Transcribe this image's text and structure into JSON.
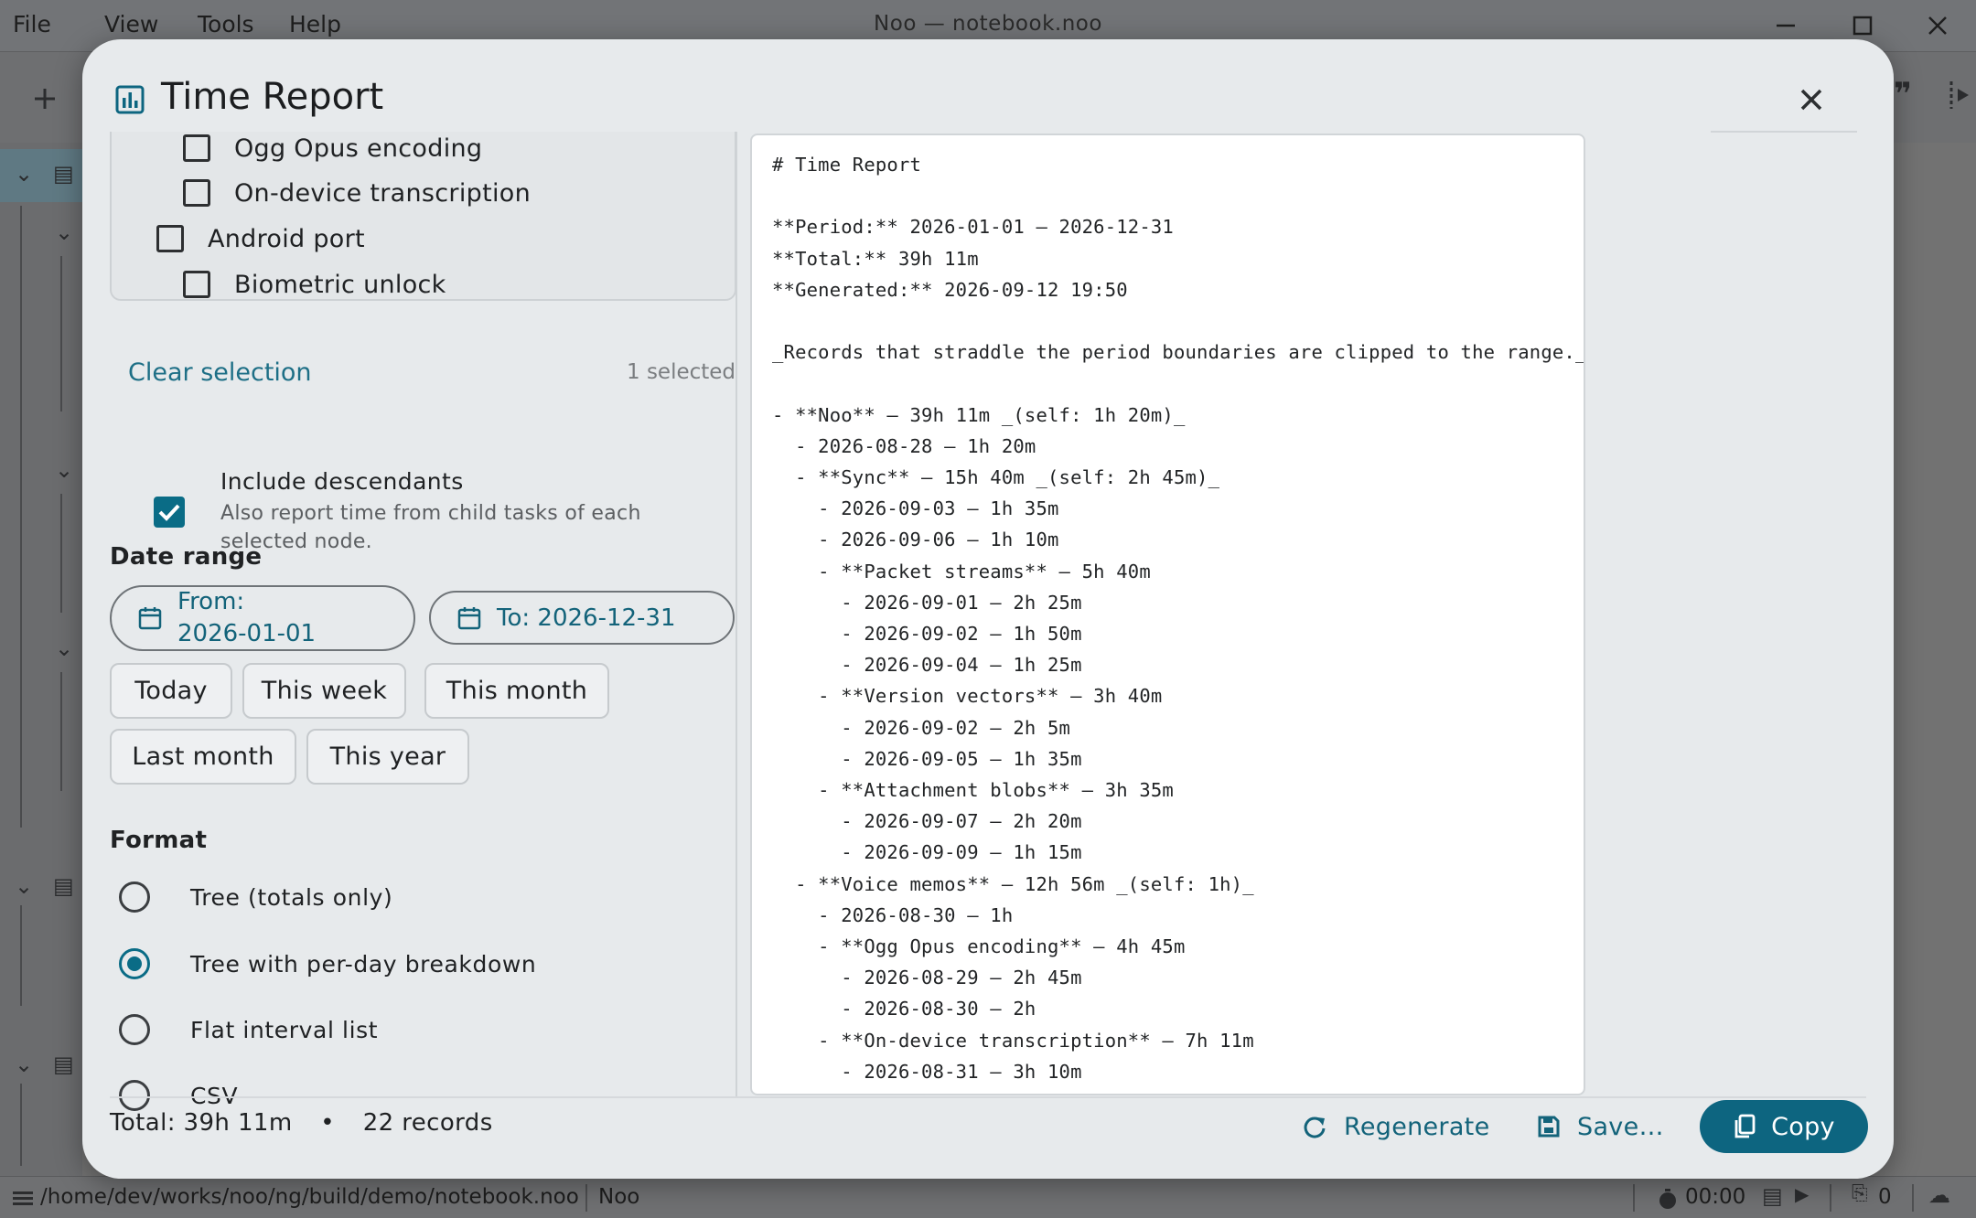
{
  "app": {
    "menu": [
      "File",
      "View",
      "Tools",
      "Help"
    ],
    "window_title": "Noo — notebook.noo",
    "status": {
      "path": "/home/dev/works/noo/ng/build/demo/notebook.noo",
      "app_name": "Noo",
      "timer": "00:00",
      "attachments": "0"
    }
  },
  "dialog": {
    "title": "Time Report",
    "task_tree": [
      {
        "label": "Ogg Opus encoding",
        "checked": false,
        "level": 2
      },
      {
        "label": "On-device transcription",
        "checked": false,
        "level": 2
      },
      {
        "label": "Android port",
        "checked": false,
        "level": 1
      },
      {
        "label": "Biometric unlock",
        "checked": false,
        "level": 2
      }
    ],
    "clear_selection": "Clear selection",
    "selected_count": "1 selected",
    "include_descendants": {
      "label": "Include descendants",
      "help": "Also report time from child tasks of each selected node.",
      "checked": true
    },
    "date_range": {
      "heading": "Date range",
      "from_label": "From:",
      "from_value": "2026-01-01",
      "to_label": "To: 2026-12-31",
      "presets": [
        "Today",
        "This week",
        "This month",
        "Last month",
        "This year"
      ]
    },
    "format": {
      "heading": "Format",
      "options": [
        "Tree (totals only)",
        "Tree with per-day breakdown",
        "Flat interval list",
        "CSV"
      ],
      "selected": "Tree with per-day breakdown"
    },
    "preview_lines": [
      "# Time Report",
      "",
      "**Period:** 2026-01-01 — 2026-12-31",
      "**Total:** 39h 11m",
      "**Generated:** 2026-09-12 19:50",
      "",
      "_Records that straddle the period boundaries are clipped to the range._",
      "",
      "- **Noo** — 39h 11m _(self: 1h 20m)_",
      "  - 2026-08-28 — 1h 20m",
      "  - **Sync** — 15h 40m _(self: 2h 45m)_",
      "    - 2026-09-03 — 1h 35m",
      "    - 2026-09-06 — 1h 10m",
      "    - **Packet streams** — 5h 40m",
      "      - 2026-09-01 — 2h 25m",
      "      - 2026-09-02 — 1h 50m",
      "      - 2026-09-04 — 1h 25m",
      "    - **Version vectors** — 3h 40m",
      "      - 2026-09-02 — 2h 5m",
      "      - 2026-09-05 — 1h 35m",
      "    - **Attachment blobs** — 3h 35m",
      "      - 2026-09-07 — 2h 20m",
      "      - 2026-09-09 — 1h 15m",
      "  - **Voice memos** — 12h 56m _(self: 1h)_",
      "    - 2026-08-30 — 1h",
      "    - **Ogg Opus encoding** — 4h 45m",
      "      - 2026-08-29 — 2h 45m",
      "      - 2026-08-30 — 2h",
      "    - **On-device transcription** — 7h 11m",
      "      - 2026-08-31 — 3h 10m"
    ],
    "footer": {
      "total": "Total: 39h 11m",
      "dot": "•",
      "records": "22 records",
      "regenerate": "Regenerate",
      "save": "Save…",
      "copy": "Copy"
    }
  }
}
